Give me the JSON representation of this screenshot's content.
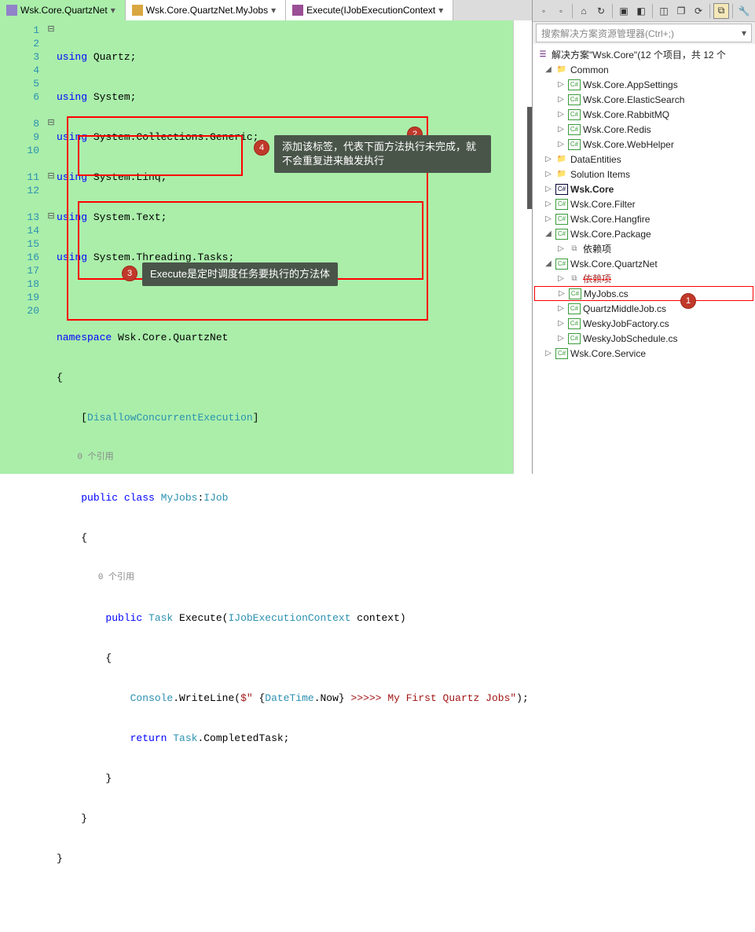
{
  "tabs": {
    "file": "Wsk.Core.QuartzNet",
    "class": "Wsk.Core.QuartzNet.MyJobs",
    "method": "Execute(IJobExecutionContext"
  },
  "gutter_lines": [
    "1",
    "2",
    "3",
    "4",
    "5",
    "6",
    "",
    "8",
    "9",
    "10",
    "",
    "11",
    "12",
    "",
    "13",
    "14",
    "15",
    "16",
    "17",
    "18",
    "19",
    "20"
  ],
  "code": {
    "us1a": "using",
    "us1b": " Quartz;",
    "us2a": "using",
    "us2b": " System;",
    "us3a": "using",
    "us3b": " System.Collections.Generic;",
    "us4a": "using",
    "us4b": " System.Linq;",
    "us5a": "using",
    "us5b": " System.Text;",
    "us6a": "using",
    "us6b": " System.Threading.Tasks;",
    "ns_a": "namespace",
    "ns_b": " Wsk.Core.QuartzNet",
    "lb": "{",
    "attr_l": "[",
    "attr": "DisallowConcurrentExecution",
    "attr_r": "]",
    "lens": "0 个引用",
    "cls_a": "public class ",
    "cls_b": "MyJobs",
    "cls_c": ":",
    "cls_d": "IJob",
    "m_a": "public ",
    "m_b": "Task ",
    "m_c": "Execute",
    "m_d": "(",
    "m_e": "IJobExecutionContext",
    "m_f": " context)",
    "cw_a": "Console",
    "cw_b": ".WriteLine(",
    "cw_c": "$\" ",
    "cw_d": "{",
    "cw_e": "DateTime",
    "cw_f": ".Now",
    "cw_g": "}",
    "cw_h": " >>>>> My First Quartz Jobs\"",
    "cw_i": ");",
    "ret_a": "return ",
    "ret_b": "Task",
    "ret_c": ".CompletedTask;",
    "rb": "}"
  },
  "tips": {
    "attr": "添加该标签，代表下面方法执行未完成，就不会重复进来触发执行",
    "exec": "Execute是定时调度任务要执行的方法体"
  },
  "badges": {
    "b1": "1",
    "b2": "2",
    "b3": "3",
    "b4": "4"
  },
  "panel": {
    "search_placeholder": "搜索解决方案资源管理器(Ctrl+;)",
    "solution": "解决方案\"Wsk.Core\"(12 个项目，共 12 个",
    "common": "Common",
    "items": [
      "Wsk.Core.AppSettings",
      "Wsk.Core.ElasticSearch",
      "Wsk.Core.RabbitMQ",
      "Wsk.Core.Redis",
      "Wsk.Core.WebHelper"
    ],
    "dataEntities": "DataEntities",
    "solutionItems": "Solution Items",
    "wskCore": "Wsk.Core",
    "filter": "Wsk.Core.Filter",
    "hangfire": "Wsk.Core.Hangfire",
    "package": "Wsk.Core.Package",
    "dep": "依赖项",
    "quartznet": "Wsk.Core.QuartzNet",
    "dep2": "依赖项",
    "myjobs": "MyJobs.cs",
    "quartzmiddle": "QuartzMiddleJob.cs",
    "weskyfactory": "WeskyJobFactory.cs",
    "weskyschedule": "WeskyJobSchedule.cs",
    "service": "Wsk.Core.Service"
  }
}
